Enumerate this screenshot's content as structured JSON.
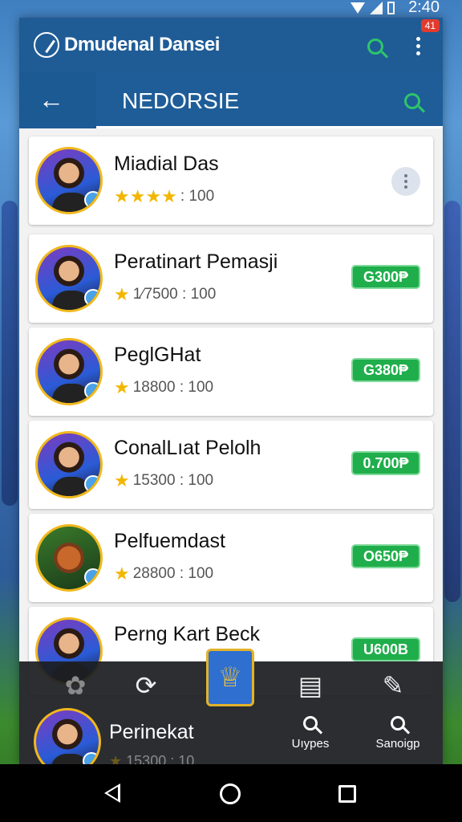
{
  "status_bar": {
    "time": "2:40"
  },
  "app_bar": {
    "title": "Dmudenal Dansei",
    "notification_count": "41"
  },
  "sub_bar": {
    "tab_label": "NEDORSIE"
  },
  "list": [
    {
      "name": "Miadial Das",
      "rating": ": 100",
      "stars": 4
    },
    {
      "name": "Peratinart Pemasji",
      "rating": "1⁄7500 : 100",
      "price": "G300₱"
    },
    {
      "name": "PeglGHat",
      "rating": "18800 : 100",
      "price": "G380₱"
    },
    {
      "name": "ConalLıat Pelolh",
      "rating": "15300 : 100",
      "price": "0.700₱"
    },
    {
      "name": "Pelfuemdast",
      "rating": "28800 : 100",
      "price": "O650₱"
    },
    {
      "name": "Perng Kart Beck",
      "price": "U600B"
    }
  ],
  "bottom_panel": {
    "user_name": "Perinekat",
    "user_rating": "15300 : 10",
    "action_left": "Uıypes",
    "action_right": "Sanoigp"
  },
  "colors": {
    "primary": "#1f5c96",
    "accent": "#1fae4b",
    "star": "#f2b600"
  }
}
